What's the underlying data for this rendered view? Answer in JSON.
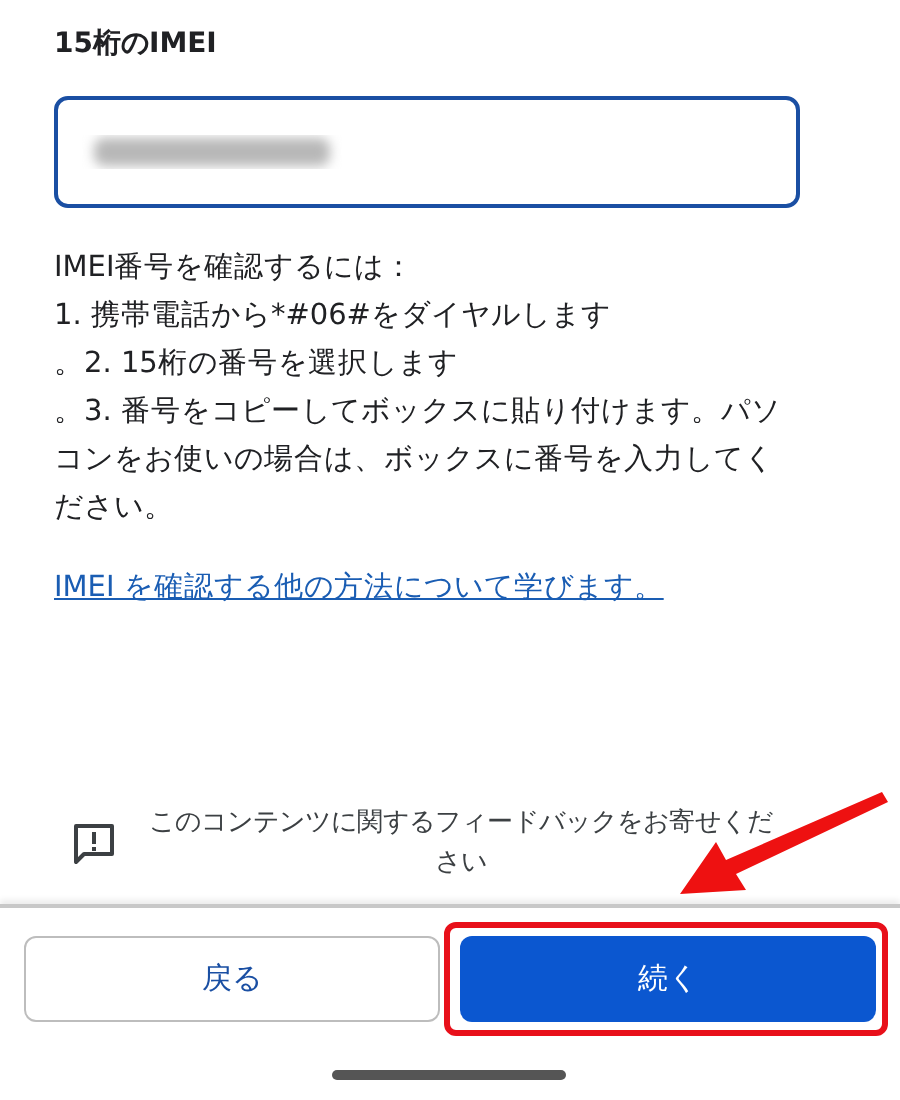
{
  "title": "15桁のIMEI",
  "imei_field": {
    "value_hidden": true,
    "focused": true
  },
  "instructions": [
    "IMEI番号を確認するには：",
    "1. 携帯電話から*#06#をダイヤルします",
    "。2. 15桁の番号を選択します",
    "。3. 番号をコピーしてボックスに貼り付けます。パソコンをお使いの場合は、ボックスに番号を入力してください。"
  ],
  "help_link": "IMEI を確認する他の方法について学びます。",
  "feedback": "このコンテンツに関するフィードバックをお寄せください",
  "buttons": [
    {
      "label": "戻る",
      "kind": "outline",
      "highlighted": false
    },
    {
      "label": "続く",
      "kind": "primary",
      "highlighted": true
    }
  ]
}
